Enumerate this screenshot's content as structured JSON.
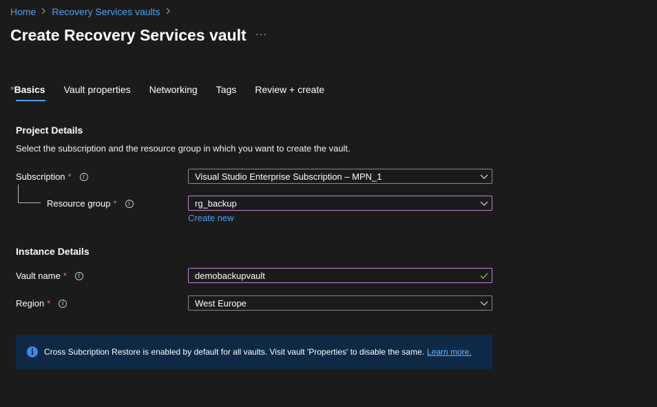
{
  "breadcrumb": {
    "home": "Home",
    "vaults": "Recovery Services vaults"
  },
  "header": {
    "title": "Create Recovery Services vault",
    "more": "···"
  },
  "tabs": [
    {
      "label": "Basics",
      "required": "*"
    },
    {
      "label": "Vault properties"
    },
    {
      "label": "Networking"
    },
    {
      "label": "Tags"
    },
    {
      "label": "Review + create"
    }
  ],
  "project": {
    "title": "Project Details",
    "description": "Select the subscription and the resource group in which you want to create the vault.",
    "subscription_label": "Subscription",
    "subscription_value": "Visual Studio Enterprise Subscription – MPN_1",
    "resource_group_label": "Resource group",
    "resource_group_value": "rg_backup",
    "create_new": "Create new"
  },
  "instance": {
    "title": "Instance Details",
    "vault_name_label": "Vault name",
    "vault_name_value": "demobackupvault",
    "region_label": "Region",
    "region_value": "West Europe"
  },
  "required_marker": "*",
  "info_glyph": "i",
  "banner": {
    "icon": "i",
    "text": "Cross Subcription Restore is enabled by default for all vaults. Visit vault 'Properties' to disable the same.",
    "link": "Learn more."
  },
  "colors": {
    "accent": "#4ea1f0",
    "required": "#f1707b",
    "focus_border": "#c586e0",
    "valid_check": "#8fd46e",
    "banner_bg": "#0e2945"
  }
}
